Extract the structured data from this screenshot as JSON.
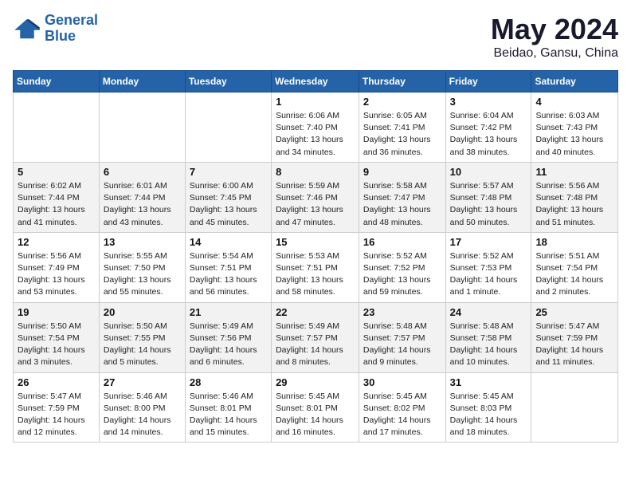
{
  "header": {
    "logo_line1": "General",
    "logo_line2": "Blue",
    "month": "May 2024",
    "location": "Beidao, Gansu, China"
  },
  "weekdays": [
    "Sunday",
    "Monday",
    "Tuesday",
    "Wednesday",
    "Thursday",
    "Friday",
    "Saturday"
  ],
  "weeks": [
    [
      {
        "day": "",
        "info": ""
      },
      {
        "day": "",
        "info": ""
      },
      {
        "day": "",
        "info": ""
      },
      {
        "day": "1",
        "info": "Sunrise: 6:06 AM\nSunset: 7:40 PM\nDaylight: 13 hours\nand 34 minutes."
      },
      {
        "day": "2",
        "info": "Sunrise: 6:05 AM\nSunset: 7:41 PM\nDaylight: 13 hours\nand 36 minutes."
      },
      {
        "day": "3",
        "info": "Sunrise: 6:04 AM\nSunset: 7:42 PM\nDaylight: 13 hours\nand 38 minutes."
      },
      {
        "day": "4",
        "info": "Sunrise: 6:03 AM\nSunset: 7:43 PM\nDaylight: 13 hours\nand 40 minutes."
      }
    ],
    [
      {
        "day": "5",
        "info": "Sunrise: 6:02 AM\nSunset: 7:44 PM\nDaylight: 13 hours\nand 41 minutes."
      },
      {
        "day": "6",
        "info": "Sunrise: 6:01 AM\nSunset: 7:44 PM\nDaylight: 13 hours\nand 43 minutes."
      },
      {
        "day": "7",
        "info": "Sunrise: 6:00 AM\nSunset: 7:45 PM\nDaylight: 13 hours\nand 45 minutes."
      },
      {
        "day": "8",
        "info": "Sunrise: 5:59 AM\nSunset: 7:46 PM\nDaylight: 13 hours\nand 47 minutes."
      },
      {
        "day": "9",
        "info": "Sunrise: 5:58 AM\nSunset: 7:47 PM\nDaylight: 13 hours\nand 48 minutes."
      },
      {
        "day": "10",
        "info": "Sunrise: 5:57 AM\nSunset: 7:48 PM\nDaylight: 13 hours\nand 50 minutes."
      },
      {
        "day": "11",
        "info": "Sunrise: 5:56 AM\nSunset: 7:48 PM\nDaylight: 13 hours\nand 51 minutes."
      }
    ],
    [
      {
        "day": "12",
        "info": "Sunrise: 5:56 AM\nSunset: 7:49 PM\nDaylight: 13 hours\nand 53 minutes."
      },
      {
        "day": "13",
        "info": "Sunrise: 5:55 AM\nSunset: 7:50 PM\nDaylight: 13 hours\nand 55 minutes."
      },
      {
        "day": "14",
        "info": "Sunrise: 5:54 AM\nSunset: 7:51 PM\nDaylight: 13 hours\nand 56 minutes."
      },
      {
        "day": "15",
        "info": "Sunrise: 5:53 AM\nSunset: 7:51 PM\nDaylight: 13 hours\nand 58 minutes."
      },
      {
        "day": "16",
        "info": "Sunrise: 5:52 AM\nSunset: 7:52 PM\nDaylight: 13 hours\nand 59 minutes."
      },
      {
        "day": "17",
        "info": "Sunrise: 5:52 AM\nSunset: 7:53 PM\nDaylight: 14 hours\nand 1 minute."
      },
      {
        "day": "18",
        "info": "Sunrise: 5:51 AM\nSunset: 7:54 PM\nDaylight: 14 hours\nand 2 minutes."
      }
    ],
    [
      {
        "day": "19",
        "info": "Sunrise: 5:50 AM\nSunset: 7:54 PM\nDaylight: 14 hours\nand 3 minutes."
      },
      {
        "day": "20",
        "info": "Sunrise: 5:50 AM\nSunset: 7:55 PM\nDaylight: 14 hours\nand 5 minutes."
      },
      {
        "day": "21",
        "info": "Sunrise: 5:49 AM\nSunset: 7:56 PM\nDaylight: 14 hours\nand 6 minutes."
      },
      {
        "day": "22",
        "info": "Sunrise: 5:49 AM\nSunset: 7:57 PM\nDaylight: 14 hours\nand 8 minutes."
      },
      {
        "day": "23",
        "info": "Sunrise: 5:48 AM\nSunset: 7:57 PM\nDaylight: 14 hours\nand 9 minutes."
      },
      {
        "day": "24",
        "info": "Sunrise: 5:48 AM\nSunset: 7:58 PM\nDaylight: 14 hours\nand 10 minutes."
      },
      {
        "day": "25",
        "info": "Sunrise: 5:47 AM\nSunset: 7:59 PM\nDaylight: 14 hours\nand 11 minutes."
      }
    ],
    [
      {
        "day": "26",
        "info": "Sunrise: 5:47 AM\nSunset: 7:59 PM\nDaylight: 14 hours\nand 12 minutes."
      },
      {
        "day": "27",
        "info": "Sunrise: 5:46 AM\nSunset: 8:00 PM\nDaylight: 14 hours\nand 14 minutes."
      },
      {
        "day": "28",
        "info": "Sunrise: 5:46 AM\nSunset: 8:01 PM\nDaylight: 14 hours\nand 15 minutes."
      },
      {
        "day": "29",
        "info": "Sunrise: 5:45 AM\nSunset: 8:01 PM\nDaylight: 14 hours\nand 16 minutes."
      },
      {
        "day": "30",
        "info": "Sunrise: 5:45 AM\nSunset: 8:02 PM\nDaylight: 14 hours\nand 17 minutes."
      },
      {
        "day": "31",
        "info": "Sunrise: 5:45 AM\nSunset: 8:03 PM\nDaylight: 14 hours\nand 18 minutes."
      },
      {
        "day": "",
        "info": ""
      }
    ]
  ]
}
